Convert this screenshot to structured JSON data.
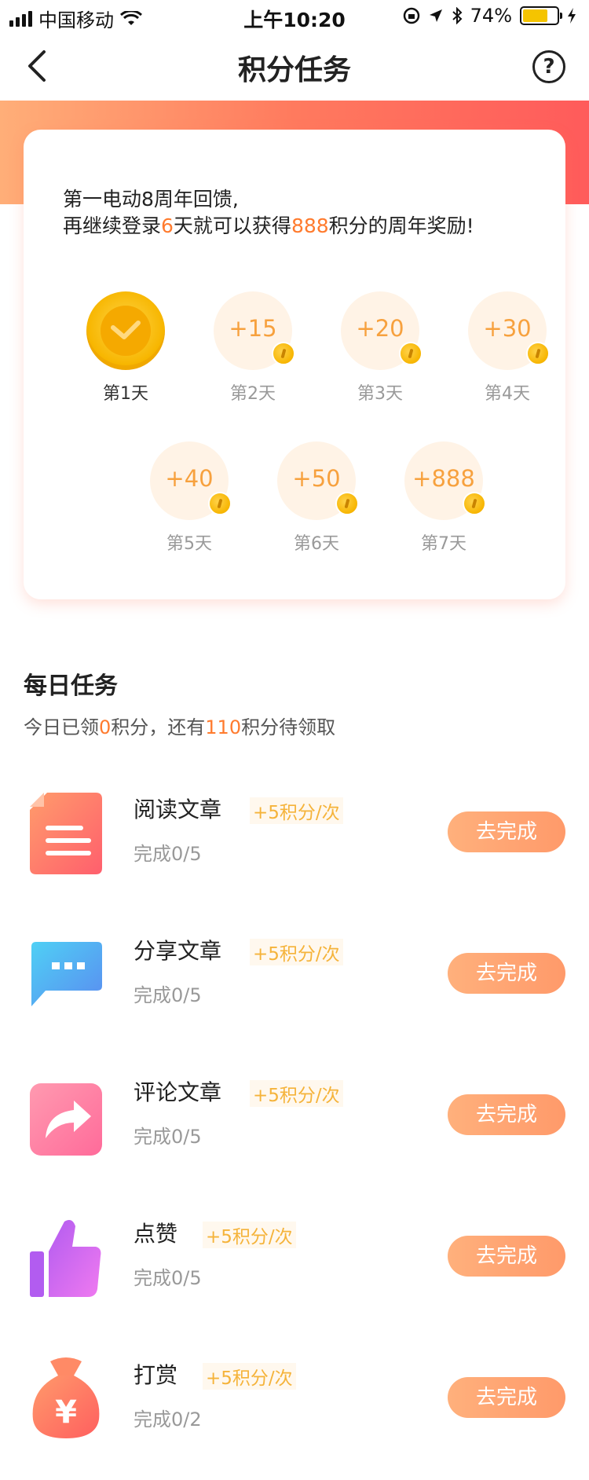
{
  "status_bar": {
    "carrier": "中国移动",
    "time": "上午10:20",
    "battery_percent": "74%",
    "battery_level": 0.74
  },
  "nav": {
    "title": "积分任务",
    "back_icon": "chevron-left-icon",
    "help_icon": "question-circle-icon",
    "help_symbol": "?"
  },
  "colors": {
    "accent_orange": "#ff7b2e",
    "reward_gold": "#f5b33a",
    "banner_start": "#ffae78",
    "banner_end": "#ff5b5b",
    "button": "#ffa073"
  },
  "checkin": {
    "line1": "第一电动8周年回馈,",
    "line2_pre": "再继续登录",
    "days_left": "6",
    "line2_mid": "天就可以获得",
    "bonus_points": "888",
    "line2_post": "积分的周年奖励!",
    "days": [
      {
        "label": "第1天",
        "points": "",
        "done": true
      },
      {
        "label": "第2天",
        "points": "+15",
        "done": false
      },
      {
        "label": "第3天",
        "points": "+20",
        "done": false
      },
      {
        "label": "第4天",
        "points": "+30",
        "done": false
      },
      {
        "label": "第5天",
        "points": "+40",
        "done": false
      },
      {
        "label": "第6天",
        "points": "+50",
        "done": false
      },
      {
        "label": "第7天",
        "points": "+888",
        "done": false
      }
    ]
  },
  "daily": {
    "title": "每日任务",
    "sub_pre": "今日已领",
    "claimed": "0",
    "sub_mid": "积分，还有",
    "remaining": "110",
    "sub_post": "积分待领取",
    "tasks": [
      {
        "name": "阅读文章",
        "reward": "+5积分/次",
        "progress": "完成0/5",
        "button": "去完成",
        "icon": "document-icon"
      },
      {
        "name": "分享文章",
        "reward": "+5积分/次",
        "progress": "完成0/5",
        "button": "去完成",
        "icon": "chat-bubble-icon"
      },
      {
        "name": "评论文章",
        "reward": "+5积分/次",
        "progress": "完成0/5",
        "button": "去完成",
        "icon": "share-arrow-icon"
      },
      {
        "name": "点赞",
        "reward": "+5积分/次",
        "progress": "完成0/5",
        "button": "去完成",
        "icon": "thumbs-up-icon"
      },
      {
        "name": "打赏",
        "reward": "+5积分/次",
        "progress": "完成0/2",
        "button": "去完成",
        "icon": "money-bag-icon",
        "icon_symbol": "¥"
      }
    ]
  }
}
